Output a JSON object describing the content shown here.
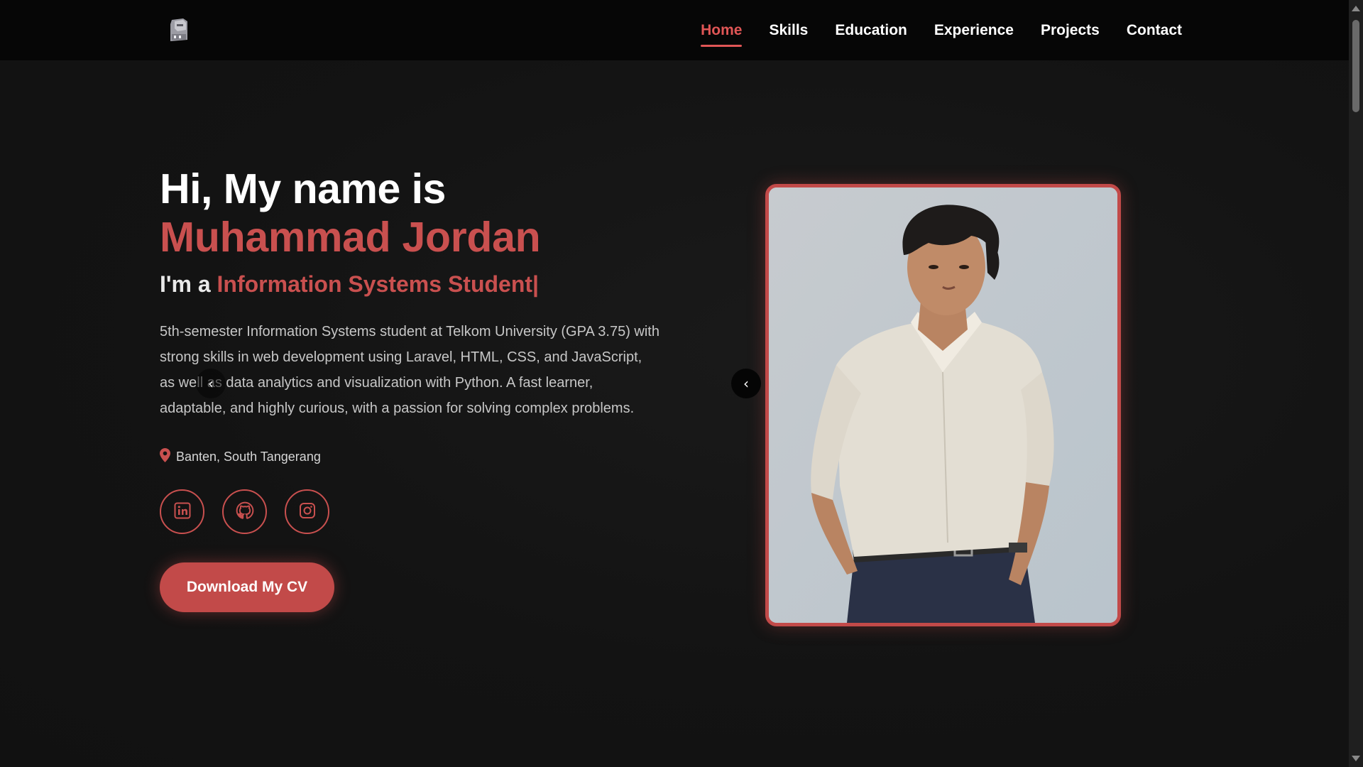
{
  "nav": {
    "logo_icon": "stone-statue-logo-icon",
    "links": [
      {
        "label": "Home",
        "active": true
      },
      {
        "label": "Skills",
        "active": false
      },
      {
        "label": "Education",
        "active": false
      },
      {
        "label": "Experience",
        "active": false
      },
      {
        "label": "Projects",
        "active": false
      },
      {
        "label": "Contact",
        "active": false
      }
    ]
  },
  "hero": {
    "greeting": "Hi, My name is",
    "name": "Muhammad Jordan",
    "role_prefix": "I'm a",
    "role_text": "Information Systems Student|",
    "bio": "5th-semester Information Systems student at Telkom University (GPA 3.75) with strong skills in web development using Laravel, HTML, CSS, and JavaScript, as well as data analytics and visualization with Python. A fast learner, adaptable, and highly curious, with a passion for solving complex problems.",
    "location": "Banten, South Tangerang",
    "location_icon": "map-pin-icon",
    "socials": [
      {
        "icon": "linkedin-icon"
      },
      {
        "icon": "github-icon"
      },
      {
        "icon": "instagram-icon"
      }
    ],
    "cta_label": "Download My CV"
  },
  "carousel": {
    "prev_glyph": "‹"
  },
  "colors": {
    "accent": "#c24a49",
    "accent_text": "#c9504f",
    "background": "#131313",
    "navbar": "#060606"
  }
}
